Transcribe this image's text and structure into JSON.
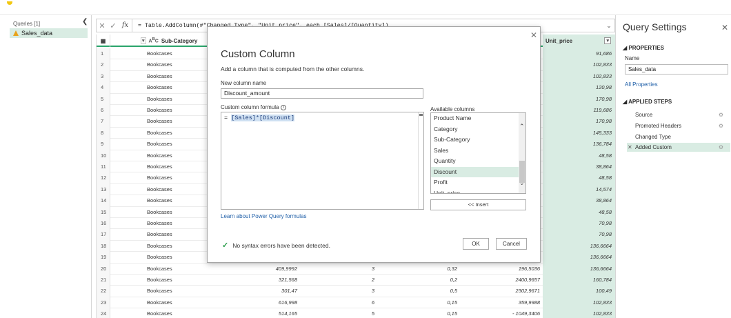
{
  "queries": {
    "header": "Queries [1]",
    "items": [
      {
        "label": "Sales_data"
      }
    ]
  },
  "formula_bar": {
    "text": "= Table.AddColumn(#\"Changed Type\", \"Unit_price\", each [Sales]/[Quantity])"
  },
  "grid": {
    "columns": {
      "subcategory": "Sub-Category",
      "unit_price": "Unit_price"
    },
    "rows": [
      {
        "n": "1",
        "cat": "Bookcases",
        "v1": "",
        "v2": "",
        "v3": "",
        "v4": "",
        "up": "91,686"
      },
      {
        "n": "2",
        "cat": "Bookcases",
        "v1": "",
        "v2": "",
        "v3": "",
        "v4": "",
        "up": "102,833"
      },
      {
        "n": "3",
        "cat": "Bookcases",
        "v1": "",
        "v2": "",
        "v3": "",
        "v4": "",
        "up": "102,833"
      },
      {
        "n": "4",
        "cat": "Bookcases",
        "v1": "",
        "v2": "",
        "v3": "",
        "v4": "",
        "up": "120,98"
      },
      {
        "n": "5",
        "cat": "Bookcases",
        "v1": "",
        "v2": "",
        "v3": "",
        "v4": "",
        "up": "170,98"
      },
      {
        "n": "6",
        "cat": "Bookcases",
        "v1": "",
        "v2": "",
        "v3": "",
        "v4": "",
        "up": "119,686"
      },
      {
        "n": "7",
        "cat": "Bookcases",
        "v1": "",
        "v2": "",
        "v3": "",
        "v4": "",
        "up": "170,98"
      },
      {
        "n": "8",
        "cat": "Bookcases",
        "v1": "",
        "v2": "",
        "v3": "",
        "v4": "",
        "up": "145,333"
      },
      {
        "n": "9",
        "cat": "Bookcases",
        "v1": "",
        "v2": "",
        "v3": "",
        "v4": "",
        "up": "136,784"
      },
      {
        "n": "10",
        "cat": "Bookcases",
        "v1": "",
        "v2": "",
        "v3": "",
        "v4": "",
        "up": "48,58"
      },
      {
        "n": "11",
        "cat": "Bookcases",
        "v1": "",
        "v2": "",
        "v3": "",
        "v4": "",
        "up": "38,864"
      },
      {
        "n": "12",
        "cat": "Bookcases",
        "v1": "",
        "v2": "",
        "v3": "",
        "v4": "",
        "up": "48,58"
      },
      {
        "n": "13",
        "cat": "Bookcases",
        "v1": "",
        "v2": "",
        "v3": "",
        "v4": "",
        "up": "14,574"
      },
      {
        "n": "14",
        "cat": "Bookcases",
        "v1": "",
        "v2": "",
        "v3": "",
        "v4": "",
        "up": "38,864"
      },
      {
        "n": "15",
        "cat": "Bookcases",
        "v1": "",
        "v2": "",
        "v3": "",
        "v4": "",
        "up": "48,58"
      },
      {
        "n": "16",
        "cat": "Bookcases",
        "v1": "",
        "v2": "",
        "v3": "",
        "v4": "",
        "up": "70,98"
      },
      {
        "n": "17",
        "cat": "Bookcases",
        "v1": "",
        "v2": "",
        "v3": "",
        "v4": "",
        "up": "70,98"
      },
      {
        "n": "18",
        "cat": "Bookcases",
        "v1": "",
        "v2": "",
        "v3": "",
        "v4": "",
        "up": "136,6664"
      },
      {
        "n": "19",
        "cat": "Bookcases",
        "v1": "",
        "v2": "",
        "v3": "",
        "v4": "",
        "up": "136,6664"
      },
      {
        "n": "20",
        "cat": "Bookcases",
        "v1": "409,9992",
        "v2": "3",
        "v3": "0,32",
        "v4": "196,5036",
        "up": "136,6664"
      },
      {
        "n": "21",
        "cat": "Bookcases",
        "v1": "321,568",
        "v2": "2",
        "v3": "0,2",
        "v4": "2400,9657",
        "up": "160,784"
      },
      {
        "n": "22",
        "cat": "Bookcases",
        "v1": "301,47",
        "v2": "3",
        "v3": "0,5",
        "v4": "2302,9671",
        "up": "100,49"
      },
      {
        "n": "23",
        "cat": "Bookcases",
        "v1": "616,998",
        "v2": "6",
        "v3": "0,15",
        "v4": "359,9988",
        "up": "102,833"
      },
      {
        "n": "24",
        "cat": "Bookcases",
        "v1": "514,165",
        "v2": "5",
        "v3": "0,15",
        "v4": "- 1049,3406",
        "up": "102,833"
      }
    ]
  },
  "query_settings": {
    "title": "Query Settings",
    "properties_label": "PROPERTIES",
    "name_label": "Name",
    "name_value": "Sales_data",
    "all_properties": "All Properties",
    "applied_steps_label": "APPLIED STEPS",
    "steps": [
      {
        "label": "Source"
      },
      {
        "label": "Promoted Headers"
      },
      {
        "label": "Changed Type"
      },
      {
        "label": "Added Custom"
      }
    ]
  },
  "dialog": {
    "title": "Custom Column",
    "description": "Add a column that is computed from the other columns.",
    "new_column_label": "New column name",
    "new_column_value": "Discount_amount",
    "formula_label": "Custom column formula",
    "formula_prefix": "= ",
    "formula_highlight": "[Sales]*[Discount]",
    "available_label": "Available columns",
    "available_columns": [
      "Product Name",
      "Category",
      "Sub-Category",
      "Sales",
      "Quantity",
      "Discount",
      "Profit",
      "Unit_price"
    ],
    "selected_column": "Discount",
    "insert_label": "<< Insert",
    "learn_link": "Learn about Power Query formulas",
    "status": "No syntax errors have been detected.",
    "ok_label": "OK",
    "cancel_label": "Cancel"
  },
  "colors": {
    "accent_green": "#2aa56b",
    "selection_bg": "#d9ece3",
    "link_blue": "#1f5fa8",
    "warning": "#e8a21a",
    "check": "#2a9d4b"
  }
}
